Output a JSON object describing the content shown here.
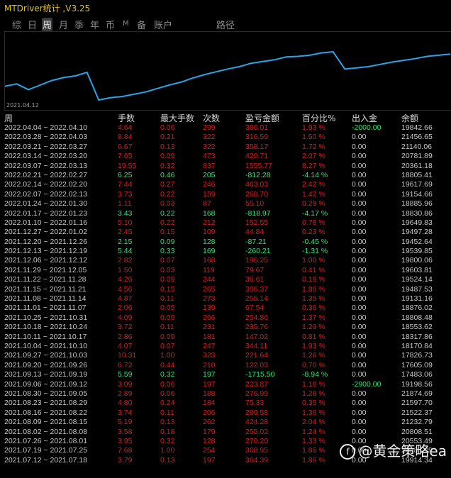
{
  "window": {
    "title": "MTDriver统计 ,V3.25"
  },
  "tabs": [
    {
      "label": "综"
    },
    {
      "label": "日"
    },
    {
      "label": "周",
      "active": true
    },
    {
      "label": "月"
    },
    {
      "label": "季"
    },
    {
      "label": "年"
    },
    {
      "label": "币"
    },
    {
      "label": "M"
    },
    {
      "label": "备"
    },
    {
      "label": "账户"
    },
    {
      "label": "路径"
    }
  ],
  "chart": {
    "start_date": "2021.04.12",
    "line_color": "#2aa3e8",
    "values": [
      19200,
      19400,
      18900,
      19300,
      19700,
      19950,
      20100,
      20400,
      18000,
      18200,
      18300,
      18500,
      18700,
      19000,
      19300,
      19550,
      19900,
      20200,
      20450,
      20700,
      20900,
      21200,
      21350,
      21500,
      21750,
      21800,
      21900,
      22100,
      22200,
      20700,
      20800,
      20900,
      21100,
      21300,
      21450,
      21600,
      21800,
      21900,
      22000
    ]
  },
  "header": {
    "week": "周",
    "lots": "手数",
    "max_lots": "最大手数",
    "count": "次数",
    "pnl": "盈亏金额",
    "pct": "百分比%",
    "io": "出入金",
    "balance": "余额"
  },
  "rows": [
    {
      "week": "2022.04.04 ~ 2022.04.10",
      "lots": "4.64",
      "max": "0.06",
      "count": "299",
      "pnl": "386.01",
      "pct": "1.93 %",
      "io": "-2000.00",
      "bal": "19842.66",
      "sign": "neg",
      "io_neg": true
    },
    {
      "week": "2022.03.28 ~ 2022.04.03",
      "lots": "8.84",
      "max": "0.21",
      "count": "322",
      "pnl": "316.59",
      "pct": "1.50 %",
      "io": "0.00",
      "bal": "21456.65",
      "sign": "neg"
    },
    {
      "week": "2022.03.21 ~ 2022.03.27",
      "lots": "6.67",
      "max": "0.13",
      "count": "322",
      "pnl": "358.17",
      "pct": "1.72 %",
      "io": "0.00",
      "bal": "21140.06",
      "sign": "neg"
    },
    {
      "week": "2022.03.14 ~ 2022.03.20",
      "lots": "7.65",
      "max": "0.09",
      "count": "473",
      "pnl": "420.71",
      "pct": "2.07 %",
      "io": "0.00",
      "bal": "20781.89",
      "sign": "neg"
    },
    {
      "week": "2022.03.07 ~ 2022.03.13",
      "lots": "19.55",
      "max": "0.32",
      "count": "837",
      "pnl": "1555.77",
      "pct": "8.27 %",
      "io": "0.00",
      "bal": "20361.18",
      "sign": "neg"
    },
    {
      "week": "2022.02.21 ~ 2022.02.27",
      "lots": "6.25",
      "max": "0.46",
      "count": "205",
      "pnl": "-812.28",
      "pct": "-4.14 %",
      "io": "0.00",
      "bal": "18805.41",
      "sign": "pos"
    },
    {
      "week": "2022.02.14 ~ 2022.02.20",
      "lots": "7.44",
      "max": "0.27",
      "count": "246",
      "pnl": "463.03",
      "pct": "2.42 %",
      "io": "0.00",
      "bal": "19617.69",
      "sign": "neg"
    },
    {
      "week": "2022.02.07 ~ 2022.02.13",
      "lots": "3.73",
      "max": "0.22",
      "count": "159",
      "pnl": "268.70",
      "pct": "1.42 %",
      "io": "0.00",
      "bal": "19154.66",
      "sign": "neg"
    },
    {
      "week": "2022.01.24 ~ 2022.01.30",
      "lots": "1.11",
      "max": "0.03",
      "count": "87",
      "pnl": "55.10",
      "pct": "0.29 %",
      "io": "0.00",
      "bal": "18885.96",
      "sign": "neg"
    },
    {
      "week": "2022.01.17 ~ 2022.01.23",
      "lots": "3.43",
      "max": "0.22",
      "count": "168",
      "pnl": "-818.97",
      "pct": "-4.17 %",
      "io": "0.00",
      "bal": "18830.86",
      "sign": "pos"
    },
    {
      "week": "2022.01.10 ~ 2022.01.16",
      "lots": "5.10",
      "max": "0.22",
      "count": "212",
      "pnl": "152.55",
      "pct": "0.78 %",
      "io": "0.00",
      "bal": "19649.83",
      "sign": "neg"
    },
    {
      "week": "2021.12.27 ~ 2022.01.02",
      "lots": "2.45",
      "max": "0.15",
      "count": "109",
      "pnl": "44.84",
      "pct": "0.23 %",
      "io": "0.00",
      "bal": "19497.28",
      "sign": "neg"
    },
    {
      "week": "2021.12.20 ~ 2021.12.26",
      "lots": "2.15",
      "max": "0.09",
      "count": "128",
      "pnl": "-87.21",
      "pct": "-0.45 %",
      "io": "0.00",
      "bal": "19452.64",
      "sign": "pos"
    },
    {
      "week": "2021.12.13 ~ 2021.12.19",
      "lots": "5.44",
      "max": "0.33",
      "count": "169",
      "pnl": "-260.21",
      "pct": "-1.31 %",
      "io": "0.00",
      "bal": "19539.85",
      "sign": "pos"
    },
    {
      "week": "2021.12.06 ~ 2021.12.12",
      "lots": "2.82",
      "max": "0.07",
      "count": "168",
      "pnl": "196.25",
      "pct": "1.00 %",
      "io": "0.00",
      "bal": "19800.06",
      "sign": "neg"
    },
    {
      "week": "2021.11.29 ~ 2021.12.05",
      "lots": "1.50",
      "max": "0.03",
      "count": "119",
      "pnl": "79.67",
      "pct": "0.41 %",
      "io": "0.00",
      "bal": "19603.81",
      "sign": "neg"
    },
    {
      "week": "2021.11.22 ~ 2021.11.28",
      "lots": "4.26",
      "max": "0.09",
      "count": "244",
      "pnl": "36.61",
      "pct": "0.19 %",
      "io": "0.00",
      "bal": "19524.14",
      "sign": "neg"
    },
    {
      "week": "2021.11.15 ~ 2021.11.21",
      "lots": "4.56",
      "max": "0.15",
      "count": "265",
      "pnl": "356.37",
      "pct": "1.86 %",
      "io": "0.00",
      "bal": "19487.53",
      "sign": "neg"
    },
    {
      "week": "2021.11.08 ~ 2021.11.14",
      "lots": "4.87",
      "max": "0.11",
      "count": "273",
      "pnl": "255.14",
      "pct": "1.35 %",
      "io": "0.00",
      "bal": "19131.16",
      "sign": "neg"
    },
    {
      "week": "2021.11.01 ~ 2021.11.07",
      "lots": "2.06",
      "max": "0.05",
      "count": "139",
      "pnl": "67.54",
      "pct": "0.36 %",
      "io": "0.00",
      "bal": "18876.02",
      "sign": "neg"
    },
    {
      "week": "2021.10.25 ~ 2021.10.31",
      "lots": "4.09",
      "max": "0.09",
      "count": "266",
      "pnl": "254.86",
      "pct": "1.37 %",
      "io": "0.00",
      "bal": "18808.48",
      "sign": "neg"
    },
    {
      "week": "2021.10.18 ~ 2021.10.24",
      "lots": "3.72",
      "max": "0.11",
      "count": "231",
      "pnl": "235.76",
      "pct": "1.29 %",
      "io": "0.00",
      "bal": "18553.62",
      "sign": "neg"
    },
    {
      "week": "2021.10.11 ~ 2021.10.17",
      "lots": "2.86",
      "max": "0.09",
      "count": "181",
      "pnl": "147.02",
      "pct": "0.81 %",
      "io": "0.00",
      "bal": "18317.86",
      "sign": "neg"
    },
    {
      "week": "2021.10.04 ~ 2021.10.10",
      "lots": "4.07",
      "max": "0.07",
      "count": "247",
      "pnl": "344.11",
      "pct": "1.93 %",
      "io": "0.00",
      "bal": "18170.84",
      "sign": "neg"
    },
    {
      "week": "2021.09.27 ~ 2021.10.03",
      "lots": "10.31",
      "max": "1.00",
      "count": "323",
      "pnl": "221.64",
      "pct": "1.26 %",
      "io": "0.00",
      "bal": "17826.73",
      "sign": "neg"
    },
    {
      "week": "2021.09.20 ~ 2021.09.26",
      "lots": "6.72",
      "max": "0.44",
      "count": "210",
      "pnl": "122.03",
      "pct": "0.70 %",
      "io": "0.00",
      "bal": "17605.09",
      "sign": "neg"
    },
    {
      "week": "2021.09.13 ~ 2021.09.19",
      "lots": "5.59",
      "max": "0.32",
      "count": "197",
      "pnl": "-1715.50",
      "pct": "-8.94 %",
      "io": "0.00",
      "bal": "17483.06",
      "sign": "pos"
    },
    {
      "week": "2021.09.06 ~ 2021.09.12",
      "lots": "3.09",
      "max": "0.06",
      "count": "197",
      "pnl": "223.87",
      "pct": "1.18 %",
      "io": "-2900.00",
      "bal": "19198.56",
      "sign": "neg",
      "io_neg": true
    },
    {
      "week": "2021.08.30 ~ 2021.09.05",
      "lots": "2.89",
      "max": "0.06",
      "count": "188",
      "pnl": "276.99",
      "pct": "1.28 %",
      "io": "0.00",
      "bal": "21874.69",
      "sign": "neg"
    },
    {
      "week": "2021.08.23 ~ 2021.08.29",
      "lots": "4.80",
      "max": "0.24",
      "count": "184",
      "pnl": "75.33",
      "pct": "0.35 %",
      "io": "0.00",
      "bal": "21597.70",
      "sign": "neg"
    },
    {
      "week": "2021.08.16 ~ 2021.08.22",
      "lots": "3.74",
      "max": "0.11",
      "count": "206",
      "pnl": "289.58",
      "pct": "1.36 %",
      "io": "0.00",
      "bal": "21522.37",
      "sign": "neg"
    },
    {
      "week": "2021.08.09 ~ 2021.08.15",
      "lots": "5.19",
      "max": "0.13",
      "count": "262",
      "pnl": "424.28",
      "pct": "2.04 %",
      "io": "0.00",
      "bal": "21232.79",
      "sign": "neg"
    },
    {
      "week": "2021.08.02 ~ 2021.08.08",
      "lots": "3.58",
      "max": "0.18",
      "count": "179",
      "pnl": "255.02",
      "pct": "1.24 %",
      "io": "0.00",
      "bal": "20808.51",
      "sign": "neg"
    },
    {
      "week": "2021.07.26 ~ 2021.08.01",
      "lots": "3.95",
      "max": "0.32",
      "count": "128",
      "pnl": "270.20",
      "pct": "1.33 %",
      "io": "0.00",
      "bal": "20553.49",
      "sign": "neg"
    },
    {
      "week": "2021.07.19 ~ 2021.07.25",
      "lots": "7.68",
      "max": "1.00",
      "count": "254",
      "pnl": "368.95",
      "pct": "1.85 %",
      "io": "0.00",
      "bal": "20283.29",
      "sign": "neg"
    },
    {
      "week": "2021.07.12 ~ 2021.07.18",
      "lots": "3.79",
      "max": "0.13",
      "count": "197",
      "pnl": "364.39",
      "pct": "1.86 %",
      "io": "0.00",
      "bal": "19914.34",
      "sign": "neg"
    }
  ],
  "watermark": {
    "text": "@黄金策略ea",
    "icon": "circle-logo-icon"
  }
}
